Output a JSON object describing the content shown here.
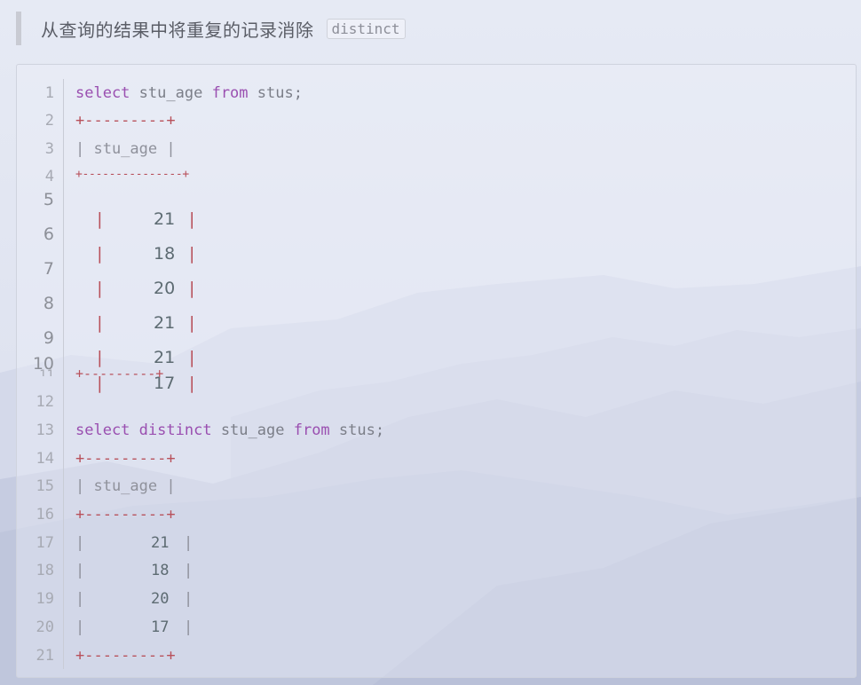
{
  "note": {
    "text": "从查询的结果中将重复的记录消除",
    "code": "distinct"
  },
  "code": {
    "line_numbers": [
      "1",
      "2",
      "3",
      "4",
      "5",
      "6",
      "7",
      "8",
      "9",
      "10",
      "11",
      "12",
      "13",
      "14",
      "15",
      "16",
      "17",
      "18",
      "19",
      "20",
      "21"
    ],
    "query1": {
      "kw1": "select",
      "col": "stu_age",
      "kw2": "from",
      "table": "stus;"
    },
    "border": "+---------+",
    "border_long": "+---------------+",
    "header": "| stu_age |",
    "rows1": [
      "21",
      "18",
      "20",
      "21",
      "21",
      "17"
    ],
    "query2": {
      "kw1": "select",
      "kw_distinct": "distinct",
      "col": "stu_age",
      "kw2": "from",
      "table": "stus;"
    },
    "rows2": [
      "21",
      "18",
      "20",
      "17"
    ],
    "pipe": "|"
  },
  "colors": {
    "keyword": "#9a4fb0",
    "border_text": "#b8505a",
    "identifier": "#7b7e88"
  }
}
